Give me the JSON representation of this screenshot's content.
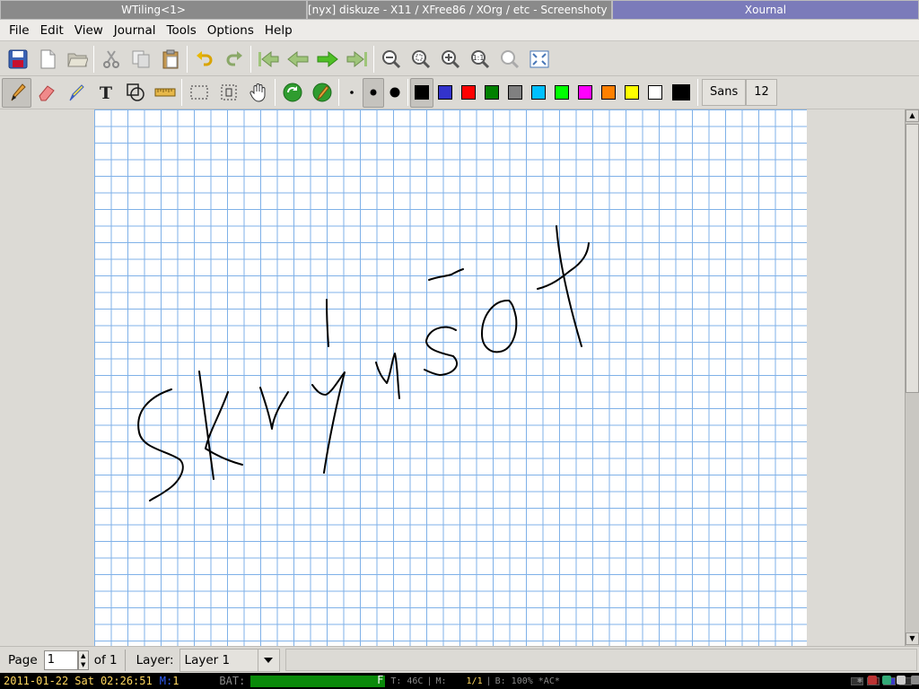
{
  "wm_tabs": [
    {
      "title": "WTiling<1>",
      "active": false
    },
    {
      "title": "[nyx] diskuze - X11 / XFree86 / XOrg / etc - Screenshoty ...",
      "active": false
    },
    {
      "title": "Xournal",
      "active": true
    }
  ],
  "menu": [
    "File",
    "Edit",
    "View",
    "Journal",
    "Tools",
    "Options",
    "Help"
  ],
  "toolbar_main_icons": [
    "save-icon",
    "new-page-icon",
    "open-folder-icon",
    "cut-icon",
    "copy-icon",
    "paste-icon",
    "undo-icon",
    "redo-icon",
    "first-page-icon",
    "previous-page-icon",
    "next-page-icon",
    "last-page-icon",
    "zoom-out-icon",
    "zoom-fit-page-icon",
    "zoom-in-icon",
    "zoom-100-icon",
    "zoom-set-icon",
    "fullscreen-icon"
  ],
  "toolbar_pen": {
    "tools": [
      "pen-icon",
      "eraser-icon",
      "highlighter-icon",
      "text-icon",
      "shape-recognizer-icon",
      "ruler-icon",
      "select-rectangle-icon",
      "select-region-icon",
      "hand-icon",
      "default-tool-icon",
      "default-pen-icon"
    ],
    "active_tool": "pen",
    "thickness": [
      "thin",
      "medium",
      "thick"
    ],
    "selected_thickness": "medium",
    "colors": [
      "#000000",
      "#3333cc",
      "#ff0000",
      "#008000",
      "#808080",
      "#00c0ff",
      "#00ff00",
      "#ff00ff",
      "#ff8000",
      "#ffff00",
      "#ffffff"
    ],
    "selected_color": "#000000",
    "current_color": "#000000",
    "font_name": "Sans",
    "font_size": "12"
  },
  "pagebar": {
    "page_label": "Page",
    "page_value": "1",
    "of_label": "of 1",
    "layer_label": "Layer:",
    "layer_value": "Layer 1"
  },
  "sysbar": {
    "date": "2011-01-22",
    "day": "Sat",
    "time": "02:26:51",
    "mail_label": "M:",
    "mail_count": "1",
    "bat_label": "BAT:",
    "bat_state": "F",
    "temp": "T: 46C",
    "mem": "M:",
    "tag": "1/1",
    "brightness": "B: 100% *AC*"
  },
  "colors": {
    "grid": "#7fb1e8",
    "ink": "#000000",
    "active_tab": "#7b7bba",
    "battery_fill": "#0a8a0a"
  }
}
